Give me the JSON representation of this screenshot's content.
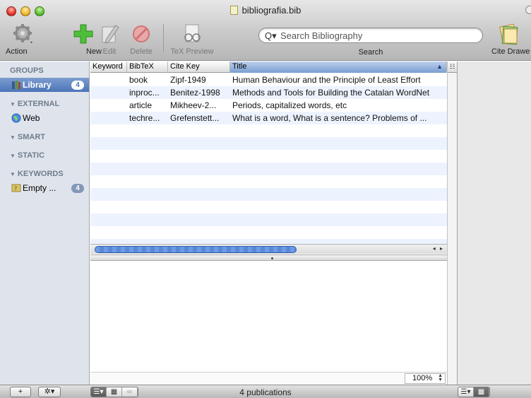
{
  "window": {
    "title": "bibliografia.bib"
  },
  "toolbar": {
    "action_label": "Action",
    "new_label": "New",
    "edit_label": "Edit",
    "delete_label": "Delete",
    "tex_preview_label": "TeX Preview",
    "search_placeholder": "Search Bibliography",
    "search_label": "Search",
    "cite_drawer_label": "Cite Drawe"
  },
  "sidebar": {
    "groups_header": "GROUPS",
    "library_label": "Library",
    "library_count": "4",
    "external_header": "EXTERNAL",
    "web_label": "Web",
    "smart_header": "SMART",
    "static_header": "STATIC",
    "keywords_header": "KEYWORDS",
    "empty_label": "Empty ...",
    "empty_count": "4"
  },
  "table": {
    "columns": [
      "Keyword",
      "BibTeX",
      "Cite Key",
      "Title"
    ],
    "rows": [
      {
        "keyword": "",
        "bibtex": "book",
        "citekey": "Zipf-1949",
        "title": "Human Behaviour and the Principle of Least Effort"
      },
      {
        "keyword": "",
        "bibtex": "inproc...",
        "citekey": "Benitez-1998",
        "title": "Methods and Tools for Building the Catalan WordNet"
      },
      {
        "keyword": "",
        "bibtex": "article",
        "citekey": "Mikheev-2...",
        "title": "Periods, capitalized words, etc"
      },
      {
        "keyword": "",
        "bibtex": "techre...",
        "citekey": "Grefenstett...",
        "title": "What is a word, What is a sentence? Problems of ..."
      }
    ]
  },
  "preview": {
    "zoom": "100%"
  },
  "status": {
    "text": "4 publications"
  },
  "colors": {
    "selection": "#4b74b8",
    "sidebar_bg": "#dfe4ec",
    "row_alt": "#edf3fe"
  }
}
